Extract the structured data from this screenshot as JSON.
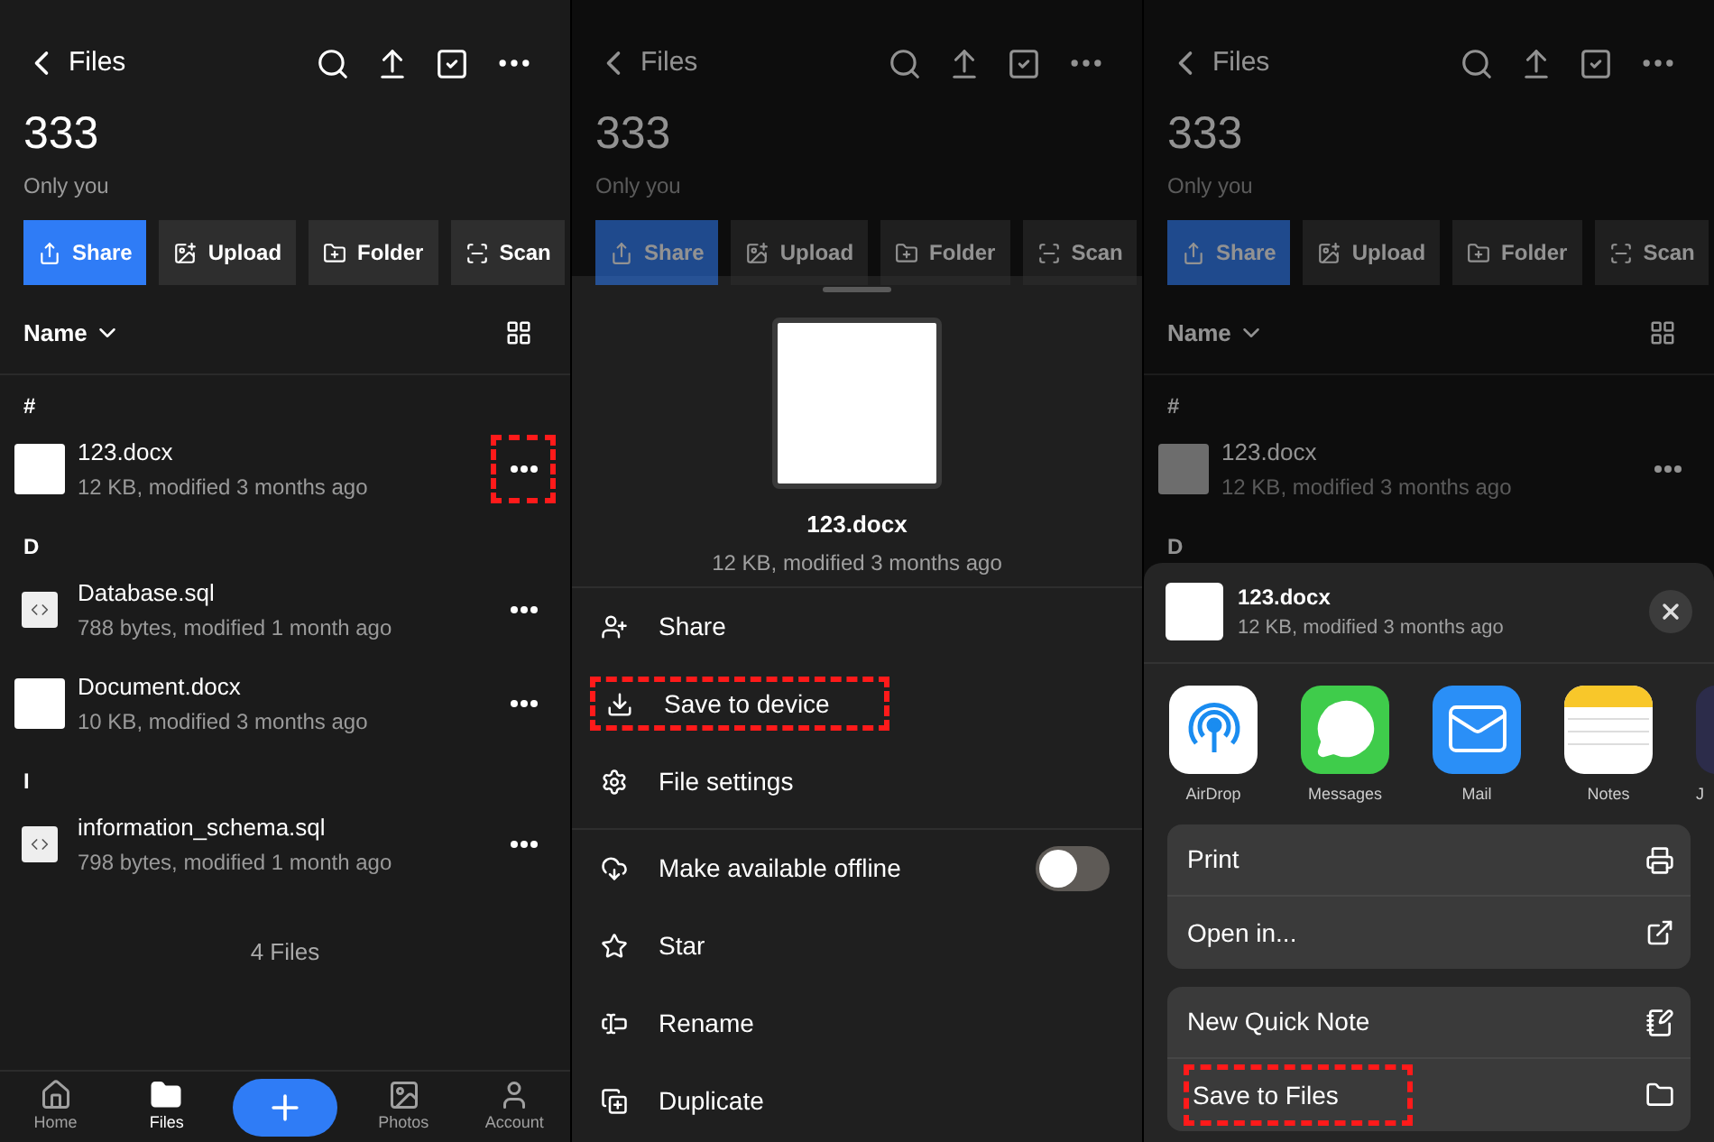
{
  "screens": [
    {
      "kind": "list",
      "dimmed": false,
      "header": {
        "back": "Files",
        "title": "333",
        "subtitle": "Only you",
        "actions": [
          {
            "label": "Share",
            "selected": true
          },
          {
            "label": "Upload",
            "selected": false
          },
          {
            "label": "Folder",
            "selected": false
          },
          {
            "label": "Scan",
            "selected": false
          }
        ]
      },
      "sort": "Name",
      "sections": [
        {
          "letter": "#",
          "files": [
            {
              "kind": "doc",
              "name": "123.docx",
              "meta": "12 KB, modified 3 months ago",
              "highlighted": true
            }
          ]
        },
        {
          "letter": "D",
          "files": [
            {
              "kind": "code",
              "name": "Database.sql",
              "meta": "788 bytes, modified 1 month ago",
              "highlighted": false
            },
            {
              "kind": "doc",
              "name": "Document.docx",
              "meta": "10 KB, modified 3 months ago",
              "highlighted": false
            }
          ]
        },
        {
          "letter": "I",
          "files": [
            {
              "kind": "code",
              "name": "information_schema.sql",
              "meta": "798 bytes, modified 1 month ago",
              "highlighted": false
            }
          ]
        }
      ],
      "footer": "4 Files",
      "tabs": [
        {
          "kind": "home",
          "label": "Home",
          "selected": false
        },
        {
          "kind": "files",
          "label": "Files",
          "selected": true
        },
        {
          "kind": "add"
        },
        {
          "kind": "photos",
          "label": "Photos",
          "selected": false
        },
        {
          "kind": "account",
          "label": "Account",
          "selected": false
        }
      ]
    },
    {
      "kind": "menu",
      "dimmed": true,
      "header": {
        "back": "Files",
        "title": "333",
        "subtitle": "Only you",
        "actions": [
          {
            "label": "Share",
            "selected": true
          },
          {
            "label": "Upload",
            "selected": false
          },
          {
            "label": "Folder",
            "selected": false
          },
          {
            "label": "Scan",
            "selected": false
          }
        ]
      },
      "sheet": {
        "name": "123.docx",
        "meta": "12 KB, modified 3 months ago",
        "groups": [
          [
            {
              "kind": "share",
              "label": "Share",
              "highlighted": false
            },
            {
              "kind": "download",
              "label": "Save to device",
              "highlighted": true
            },
            {
              "kind": "settings",
              "label": "File settings",
              "highlighted": false
            }
          ],
          [
            {
              "kind": "offline",
              "label": "Make available offline",
              "highlighted": false,
              "on": false
            },
            {
              "kind": "star",
              "label": "Star",
              "highlighted": false
            },
            {
              "kind": "rename",
              "label": "Rename",
              "highlighted": false
            },
            {
              "kind": "duplicate",
              "label": "Duplicate",
              "highlighted": false
            }
          ]
        ]
      }
    },
    {
      "kind": "share",
      "dimmed": true,
      "header": {
        "back": "Files",
        "title": "333",
        "subtitle": "Only you",
        "actions": [
          {
            "label": "Share",
            "selected": true
          },
          {
            "label": "Upload",
            "selected": false
          },
          {
            "label": "Folder",
            "selected": false
          },
          {
            "label": "Scan",
            "selected": false
          }
        ]
      },
      "sort": "Name",
      "sections": [
        {
          "letter": "#",
          "files": [
            {
              "kind": "doc",
              "name": "123.docx",
              "meta": "12 KB, modified 3 months ago",
              "highlighted": false
            }
          ]
        },
        {
          "letter": "D"
        }
      ],
      "sheet": {
        "name": "123.docx",
        "meta": "12 KB, modified 3 months ago",
        "apps": [
          {
            "kind": "airdrop",
            "label": "AirDrop"
          },
          {
            "kind": "messages",
            "label": "Messages"
          },
          {
            "kind": "mail",
            "label": "Mail"
          },
          {
            "kind": "notes",
            "label": "Notes"
          },
          {
            "kind": "other",
            "label": "J"
          }
        ],
        "groups": [
          [
            {
              "kind": "print",
              "label": "Print",
              "highlighted": false
            },
            {
              "kind": "open",
              "label": "Open in...",
              "highlighted": false
            }
          ],
          [
            {
              "kind": "note",
              "label": "New Quick Note",
              "highlighted": false
            },
            {
              "kind": "folder",
              "label": "Save to Files",
              "highlighted": true
            }
          ]
        ]
      }
    }
  ]
}
